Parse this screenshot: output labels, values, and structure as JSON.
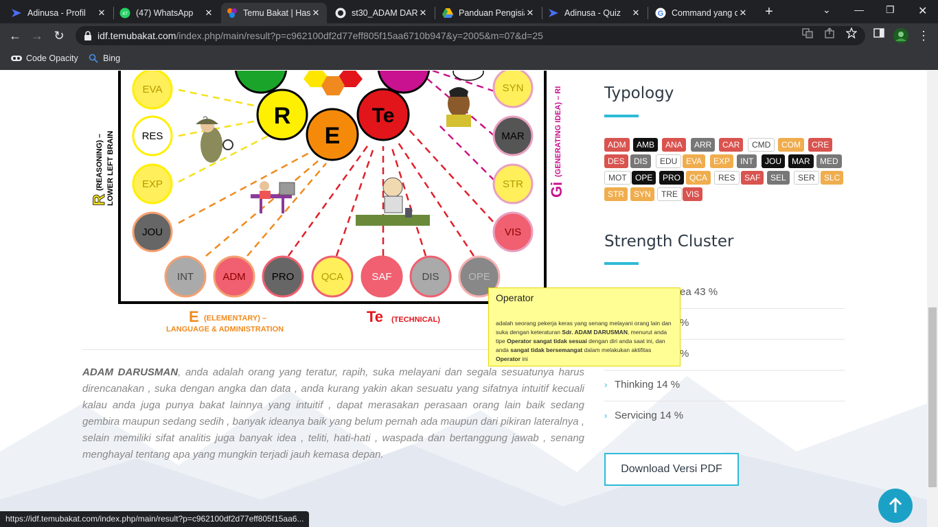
{
  "browser": {
    "tabs": [
      {
        "title": "Adinusa - Profil",
        "icon": "adinusa-icon"
      },
      {
        "title": "(47) WhatsApp",
        "icon": "whatsapp-icon",
        "badge": "47"
      },
      {
        "title": "Temu Bakat | Has",
        "icon": "temubakat-icon"
      },
      {
        "title": "st30_ADAM DAR",
        "icon": "github-icon"
      },
      {
        "title": "Panduan Pengisia",
        "icon": "google-drive-icon"
      },
      {
        "title": "Adinusa - Quiz",
        "icon": "adinusa-icon"
      },
      {
        "title": "Command yang d",
        "icon": "google-icon"
      }
    ],
    "url_domain": "idf.temubakat.com",
    "url_path": "/index.php/main/result?p=c962100df2d77eff805f15aa6710b947&y=2005&m=07&d=25",
    "bookmarks": [
      {
        "label": "Code Opacity",
        "icon": "code-opacity-icon"
      },
      {
        "label": "Bing",
        "icon": "bing-search-icon"
      }
    ],
    "status_url": "https://idf.temubakat.com/index.php/main/result?p=c962100df2d77eff805f15aa6..."
  },
  "diagram": {
    "side_left_big": "R",
    "side_left_small": "(REASONING) –",
    "side_left_small2": "LOWER LEFT BRAIN",
    "side_right_big": "Gi",
    "side_right_small": "(GENERATING IDEA) – RI",
    "bottom_e": "E",
    "bottom_e_text": "(ELEMENTARY) –",
    "bottom_e_text2": "LANGUAGE & ADMINISTRATION",
    "bottom_te": "Te",
    "bottom_te_text": "(TECHNICAL)",
    "center": [
      "R",
      "E",
      "Te"
    ],
    "left_circles": [
      "EVA",
      "RES",
      "EXP",
      "JOU"
    ],
    "right_circles": [
      "SYN",
      "MAR",
      "STR",
      "VIS"
    ],
    "bottom_circles": [
      "INT",
      "ADM",
      "PRO",
      "QCA",
      "SAF",
      "DIS",
      "OPE"
    ]
  },
  "description": {
    "name": "ADAM DARUSMAN",
    "text": ", anda adalah orang yang teratur, rapih, suka melayani dan segala sesuatunya harus direncanakan , suka dengan angka dan data , anda kurang yakin akan sesuatu yang sifatnya intuitif kecuali kalau anda juga punya bakat lainnya yang intuitif , dapat merasakan perasaan orang lain baik sedang gembira maupun sedang sedih , banyak ideanya baik yang belum pernah ada maupun dari pikiran lateralnya , selain memiliki sifat analitis juga banyak idea , teliti, hati-hati , waspada dan bertanggung jawab , senang menghayal tentang apa yang mungkin terjadi jauh kemasa depan."
  },
  "typology": {
    "heading": "Typology",
    "badges": [
      {
        "label": "ADM",
        "style": "red"
      },
      {
        "label": "AMB",
        "style": "dark"
      },
      {
        "label": "ANA",
        "style": "red"
      },
      {
        "label": "ARR",
        "style": "gray"
      },
      {
        "label": "CAR",
        "style": "red"
      },
      {
        "label": "CMD",
        "style": "white"
      },
      {
        "label": "COM",
        "style": "orange"
      },
      {
        "label": "CRE",
        "style": "red"
      },
      {
        "label": "DES",
        "style": "red"
      },
      {
        "label": "DIS",
        "style": "gray"
      },
      {
        "label": "EDU",
        "style": "white"
      },
      {
        "label": "EVA",
        "style": "orange"
      },
      {
        "label": "EXP",
        "style": "orange"
      },
      {
        "label": "INT",
        "style": "gray"
      },
      {
        "label": "JOU",
        "style": "dark"
      },
      {
        "label": "MAR",
        "style": "dark"
      },
      {
        "label": "MED",
        "style": "gray"
      },
      {
        "label": "MOT",
        "style": "white"
      },
      {
        "label": "OPE",
        "style": "dark"
      },
      {
        "label": "PRO",
        "style": "dark"
      },
      {
        "label": "QCA",
        "style": "orange"
      },
      {
        "label": "RES",
        "style": "white"
      },
      {
        "label": "SAF",
        "style": "red"
      },
      {
        "label": "SEL",
        "style": "gray"
      },
      {
        "label": "SER",
        "style": "white"
      },
      {
        "label": "SLC",
        "style": "orange"
      },
      {
        "label": "STR",
        "style": "orange"
      },
      {
        "label": "SYN",
        "style": "orange"
      },
      {
        "label": "TRE",
        "style": "white"
      },
      {
        "label": "VIS",
        "style": "red"
      }
    ]
  },
  "strength": {
    "heading": "Strength Cluster",
    "items": [
      {
        "label": "ea 43 %"
      },
      {
        "label": "%"
      },
      {
        "label": "%"
      },
      {
        "label": "Thinking 14 %"
      },
      {
        "label": "Servicing 14 %"
      }
    ],
    "download_label": "Download Versi PDF"
  },
  "tooltip": {
    "title": "Operator",
    "body_1": "adalah seorang pekerja keras yang senang melayani orang lain dan suka dengan keteraturan ",
    "body_name": "Sdr. ADAM DARUSMAN",
    "body_2": ", menurut anda tipe ",
    "body_strong1": "Operator sangat tidak sesuai",
    "body_3": " dengan diri anda saat ini, dan anda ",
    "body_strong2": "sangat tidak bersemangat",
    "body_4": " dalam melakukan aktifitas ",
    "body_strong3": "Operator",
    "body_5": " ini"
  },
  "colors": {
    "accent": "#2cbbd7",
    "badge_red": "#d9534f",
    "badge_orange": "#f0ad4e",
    "badge_gray": "#777777",
    "badge_dark": "#111111",
    "tooltip_bg": "#fffe94"
  }
}
